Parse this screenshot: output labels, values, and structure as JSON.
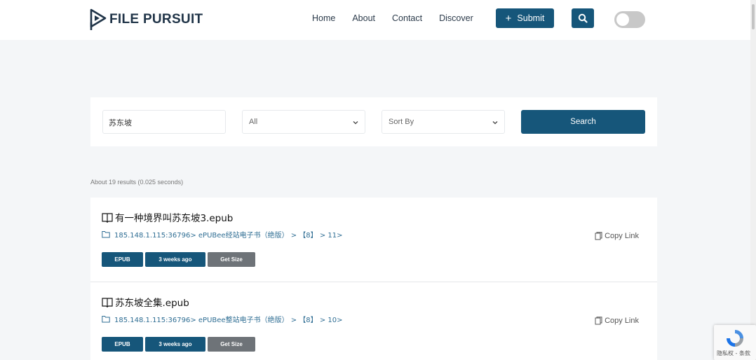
{
  "header": {
    "logo_text": "FILE PURSUIT",
    "nav": [
      "Home",
      "About",
      "Contact",
      "Discover"
    ],
    "submit_label": "Submit",
    "submit_icon": "plus-icon",
    "search_icon": "search-icon",
    "theme_toggle": "off"
  },
  "search": {
    "query": "苏东坡",
    "type_selected": "All",
    "sort_placeholder": "Sort By",
    "button_label": "Search"
  },
  "results_info": "About 19 results (0.025 seconds)",
  "results": [
    {
      "title": "有一种境界叫苏东坡3.epub",
      "path": "185.148.1.115:36796> ePUBee经站电子书（绝版） > 【8】 > 11>",
      "copy_label": "Copy Link",
      "ext": "EPUB",
      "age": "3 weeks ago",
      "size_label": "Get Size"
    },
    {
      "title": "苏东坡全集.epub",
      "path": "185.148.1.115:36796> ePUBee整站电子书（绝版） > 【8】 > 10>",
      "copy_label": "Copy Link",
      "ext": "EPUB",
      "age": "3 weeks ago",
      "size_label": "Get Size"
    }
  ],
  "recaptcha_text": "隐私权 - 条款",
  "colors": {
    "primary": "#16567a",
    "muted_button": "#6e7378",
    "background": "#f4f6f8",
    "path_link": "#2e6d93"
  }
}
